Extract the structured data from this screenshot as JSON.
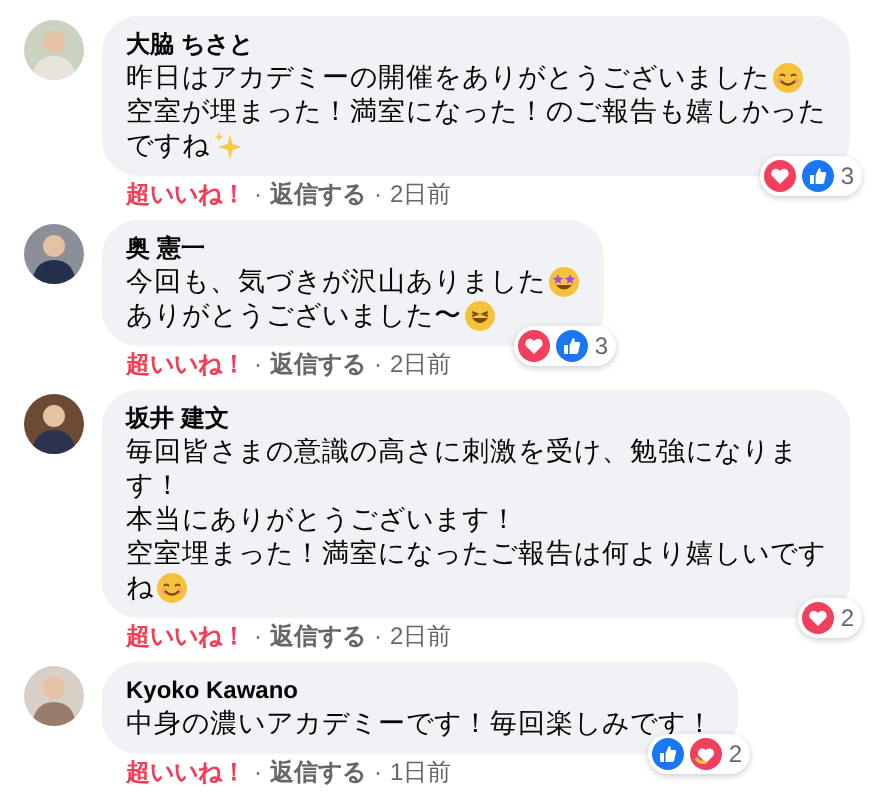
{
  "comments": [
    {
      "author": "大脇 ちさと",
      "lines": [
        {
          "text": "昨日はアカデミーの開催をありがとうございました",
          "emoji": {
            "kind": "smile"
          }
        },
        {
          "text": "空室が埋まった！満室になった！のご報告も嬉しかった"
        },
        {
          "text": "ですね",
          "emoji": {
            "kind": "sparkles"
          }
        }
      ],
      "reactions": [
        {
          "kind": "love"
        },
        {
          "kind": "like"
        }
      ],
      "reaction_count": "3",
      "actions": {
        "like": "超いいね！",
        "separator_1": "·",
        "reply": "返信する",
        "separator_2": "·",
        "time": "2日前"
      }
    },
    {
      "author": "奥 憲一",
      "lines": [
        {
          "text": "今回も、気づきが沢山ありました",
          "emoji": {
            "kind": "star-eyes"
          }
        },
        {
          "text": "ありがとうございました〜",
          "emoji": {
            "kind": "grin"
          }
        }
      ],
      "reactions": [
        {
          "kind": "love"
        },
        {
          "kind": "like"
        }
      ],
      "reaction_count": "3",
      "actions": {
        "like": "超いいね！",
        "separator_1": "·",
        "reply": "返信する",
        "separator_2": "·",
        "time": "2日前"
      }
    },
    {
      "author": "坂井 建文",
      "lines": [
        {
          "text": "毎回皆さまの意識の高さに刺激を受け、勉強になりま"
        },
        {
          "text": "す！"
        },
        {
          "text": "本当にありがとうございます！"
        },
        {
          "text": "空室埋まった！満室になったご報告は何より嬉しいです"
        },
        {
          "text": "ね",
          "emoji": {
            "kind": "smile"
          }
        }
      ],
      "reactions": [
        {
          "kind": "love"
        }
      ],
      "reaction_count": "2",
      "actions": {
        "like": "超いいね！",
        "separator_1": "·",
        "reply": "返信する",
        "separator_2": "·",
        "time": "2日前"
      }
    },
    {
      "author": "Kyoko Kawano",
      "lines": [
        {
          "text": "中身の濃いアカデミーです！毎回楽しみです！"
        }
      ],
      "reactions": [
        {
          "kind": "like"
        },
        {
          "kind": "care"
        }
      ],
      "reaction_count": "2",
      "actions": {
        "like": "超いいね！",
        "separator_1": "·",
        "reply": "返信する",
        "separator_2": "·",
        "time": "1日前"
      }
    }
  ]
}
